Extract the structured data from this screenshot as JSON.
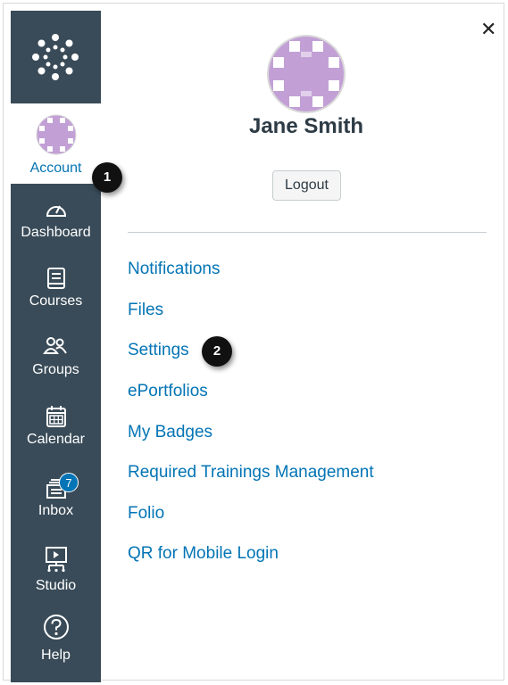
{
  "nav": {
    "account_label": "Account",
    "items": [
      {
        "label": "Dashboard",
        "icon": "dashboard-icon"
      },
      {
        "label": "Courses",
        "icon": "courses-icon"
      },
      {
        "label": "Groups",
        "icon": "groups-icon"
      },
      {
        "label": "Calendar",
        "icon": "calendar-icon"
      },
      {
        "label": "Inbox",
        "icon": "inbox-icon",
        "badge": "7"
      },
      {
        "label": "Studio",
        "icon": "studio-icon"
      },
      {
        "label": "Help",
        "icon": "help-icon"
      }
    ]
  },
  "tray": {
    "user_name": "Jane Smith",
    "logout_label": "Logout",
    "links": [
      "Notifications",
      "Files",
      "Settings",
      "ePortfolios",
      "My Badges",
      "Required Trainings Management",
      "Folio",
      "QR for Mobile Login"
    ]
  },
  "callouts": [
    "1",
    "2"
  ],
  "colors": {
    "nav_bg": "#394b58",
    "link": "#0374b5",
    "avatar": "#c2a0d6",
    "badge": "#0374b5"
  }
}
